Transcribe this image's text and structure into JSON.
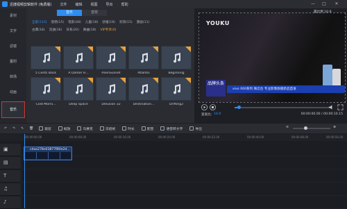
{
  "title_bar": {
    "app_title": "迅捷视频剪辑软件 (免费版)",
    "menus": [
      "文件",
      "编辑",
      "视图",
      "导出",
      "帮助"
    ]
  },
  "sidebar": {
    "items": [
      {
        "label": "素材"
      },
      {
        "label": "文字"
      },
      {
        "label": "滤镜"
      },
      {
        "label": "叠附"
      },
      {
        "label": "转场"
      },
      {
        "label": "动画"
      },
      {
        "label": "音乐"
      }
    ],
    "active_index": 6
  },
  "library": {
    "tabs": [
      {
        "label": "音乐",
        "active": true
      },
      {
        "label": "音效",
        "active": false
      }
    ],
    "categories_row1": [
      "全部(110)",
      "悠扬(15)",
      "电影(48)",
      "儿童(18)",
      "舒缓(18)",
      "欢快(15)",
      "激励(11)"
    ],
    "categories_row2": [
      "古典(18)",
      "流通(18)",
      "日系(20)",
      "舞曲(18)",
      "VIP专享(0)"
    ],
    "active_category": "全部(110)",
    "cards": [
      {
        "label": "5 Cents Back"
      },
      {
        "label": "A Darker H..."
      },
      {
        "label": "AlienSunset"
      },
      {
        "label": "Atlantis"
      },
      {
        "label": "Beginning"
      },
      {
        "label": "Cold Morni..."
      },
      {
        "label": "Deep Space"
      },
      {
        "label": "Delusion 32"
      },
      {
        "label": "Destination..."
      },
      {
        "label": "Drifting2"
      }
    ]
  },
  "preview": {
    "watermark": "YOUKU",
    "ratio_label": "最比例 16:9",
    "ad_logo_text": "品牌头条",
    "ad_text": "vivo X60系列 微云台 专业影像旗舰新品首发",
    "aspect_label": "宽高比:",
    "aspect_value": "16:9",
    "time": "00:00:00.00 / 00:00:10.15"
  },
  "toolbar": {
    "items": [
      "裁剪",
      "缩放",
      "马赛克",
      "冻结帧",
      "时长",
      "配音",
      "语音转文字",
      "导出"
    ]
  },
  "ruler_ticks": [
    "00:00:00.00",
    "00:00:08.00",
    "00:00:16.00",
    "00:00:24.00",
    "00:00:32.00",
    "00:00:40.00",
    "00:00:48.00",
    "00:00:56.00"
  ],
  "timeline": {
    "clip_label": "cdaa278e03877f80e2d..."
  }
}
